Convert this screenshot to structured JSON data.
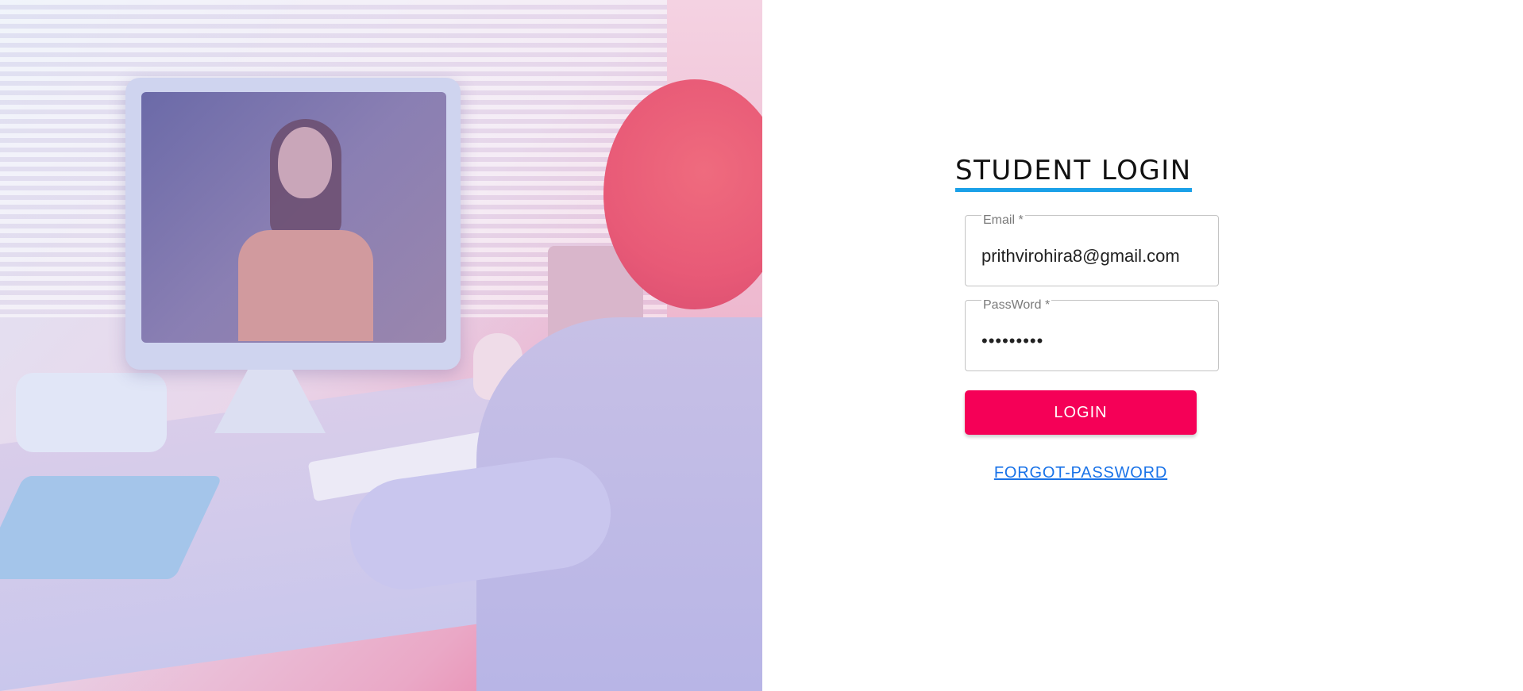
{
  "hero": {
    "description": ""
  },
  "login": {
    "title": "STUDENT LOGIN",
    "email": {
      "label": "Email *",
      "value": "prithvirohira8@gmail.com"
    },
    "password": {
      "label": "PassWord *",
      "value": "•••••••••"
    },
    "submit_label": "LOGIN",
    "forgot_label": "FORGOT-PASSWORD"
  },
  "colors": {
    "accent_underline": "#1aa0e8",
    "button": "#f50057",
    "link": "#1a73e8"
  }
}
